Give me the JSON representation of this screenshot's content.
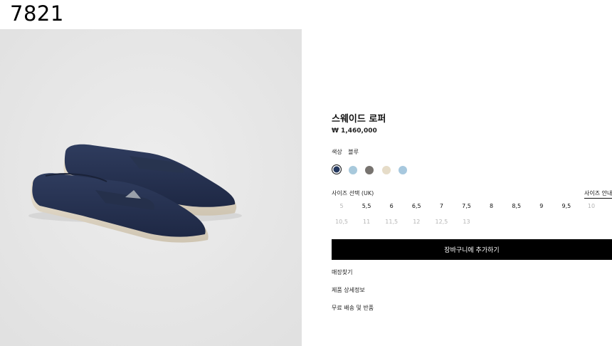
{
  "id_label": "7821",
  "product": {
    "title": "스웨이드 로퍼",
    "price": "₩ 1,460,000"
  },
  "color": {
    "label": "색상",
    "selected_name": "블루",
    "swatches": [
      {
        "color": "#23375e",
        "selected": true
      },
      {
        "color": "#a8c9dc",
        "selected": false
      },
      {
        "color": "#77736f",
        "selected": false
      },
      {
        "color": "#e6dcc8",
        "selected": false
      },
      {
        "color": "#a7c8de",
        "selected": false
      }
    ]
  },
  "size": {
    "label": "사이즈 선택 (UK)",
    "guide_link": "사이즈 안내",
    "rows": [
      [
        {
          "label": "5",
          "available": false
        },
        {
          "label": "5,5",
          "available": true
        },
        {
          "label": "6",
          "available": true
        },
        {
          "label": "6,5",
          "available": true
        },
        {
          "label": "7",
          "available": true
        },
        {
          "label": "7,5",
          "available": true
        },
        {
          "label": "8",
          "available": true
        },
        {
          "label": "8,5",
          "available": true
        },
        {
          "label": "9",
          "available": true
        },
        {
          "label": "9,5",
          "available": true
        },
        {
          "label": "10",
          "available": false
        }
      ],
      [
        {
          "label": "10,5",
          "available": false
        },
        {
          "label": "11",
          "available": false
        },
        {
          "label": "11,5",
          "available": false
        },
        {
          "label": "12",
          "available": false
        },
        {
          "label": "12,5",
          "available": false
        },
        {
          "label": "13",
          "available": false
        }
      ]
    ]
  },
  "cart_button": "장바구니에 추가하기",
  "links": [
    "매장찾기",
    "제품 상세정보",
    "무료 배송 및 반품"
  ]
}
